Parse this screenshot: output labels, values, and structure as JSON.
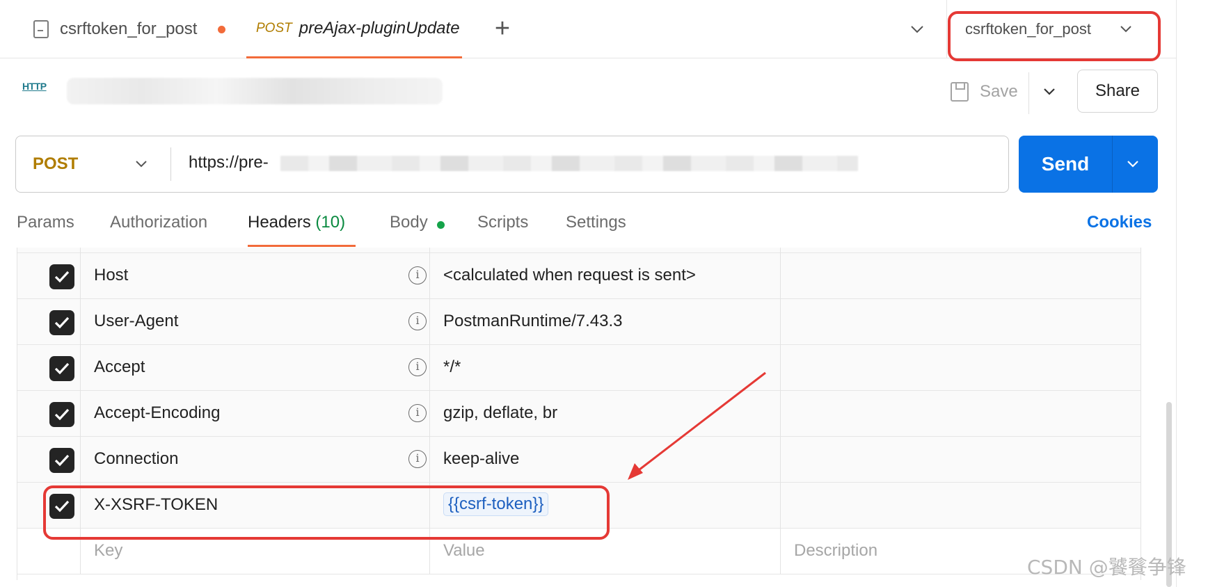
{
  "tabs": {
    "items": [
      {
        "label": "csrftoken_for_post"
      },
      {
        "method": "POST",
        "label": "preAjax-pluginUpdate"
      }
    ],
    "new_tab_symbol": "+"
  },
  "environment": {
    "selected": "csrftoken_for_post"
  },
  "request": {
    "type_badge": "HTTP",
    "save_label": "Save",
    "share_label": "Share",
    "method": "POST",
    "url": "https://pre-",
    "send_label": "Send"
  },
  "subtabs": {
    "params": "Params",
    "authorization": "Authorization",
    "headers": "Headers",
    "headers_count": "(10)",
    "body": "Body",
    "scripts": "Scripts",
    "settings": "Settings",
    "cookies": "Cookies"
  },
  "headers_table": {
    "rows": [
      {
        "key": "Host",
        "value": "<calculated when request is sent>",
        "checked": true
      },
      {
        "key": "User-Agent",
        "value": "PostmanRuntime/7.43.3",
        "checked": true
      },
      {
        "key": "Accept",
        "value": "*/*",
        "checked": true
      },
      {
        "key": "Accept-Encoding",
        "value": "gzip, deflate, br",
        "checked": true
      },
      {
        "key": "Connection",
        "value": "keep-alive",
        "checked": true
      },
      {
        "key": "X-XSRF-TOKEN",
        "value": "{{csrf-token}}",
        "checked": true
      }
    ],
    "placeholders": {
      "key": "Key",
      "value": "Value",
      "description": "Description"
    }
  },
  "watermark": "CSDN @饕餮争锋",
  "colors": {
    "accent": "#f26b3a",
    "send": "#0a72e5",
    "method": "#b07d00",
    "annotation": "#e53935",
    "variable": "#1d5fbf"
  }
}
